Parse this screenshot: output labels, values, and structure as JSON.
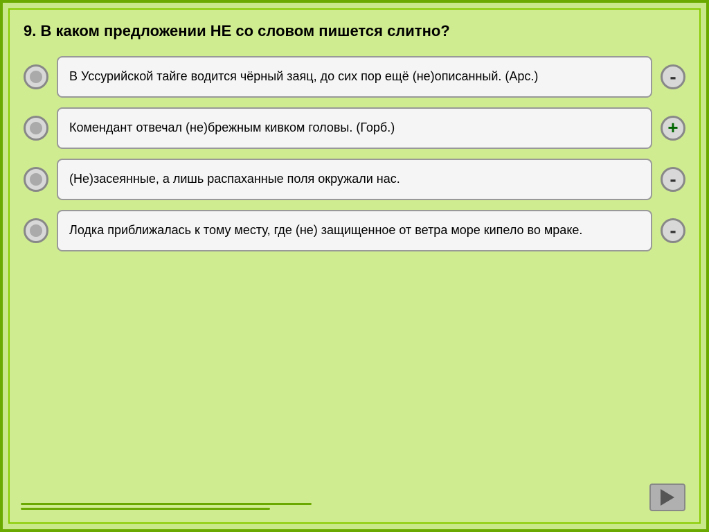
{
  "question": {
    "number": "9.",
    "text": "9.  В  каком  предложении  НЕ  со  словом  пишется слитно?"
  },
  "answers": [
    {
      "id": 1,
      "text": "В Уссурийской тайге водится чёрный заяц, до сих пор ещё (не)описанный. (Арс.)",
      "sign": "-",
      "sign_type": "minus"
    },
    {
      "id": 2,
      "text": "Комендант отвечал (не)брежным кивком головы. (Горб.)",
      "sign": "+",
      "sign_type": "plus"
    },
    {
      "id": 3,
      "text": "(Не)засеянные,  а  лишь  распаханные  поля окружали нас.",
      "sign": "-",
      "sign_type": "minus"
    },
    {
      "id": 4,
      "text": "Лодка  приближалась  к  тому  месту,  где  (не) защищенное от ветра море кипело во мраке.",
      "sign": "-",
      "sign_type": "minus"
    }
  ],
  "nav": {
    "next_label": "▶"
  }
}
